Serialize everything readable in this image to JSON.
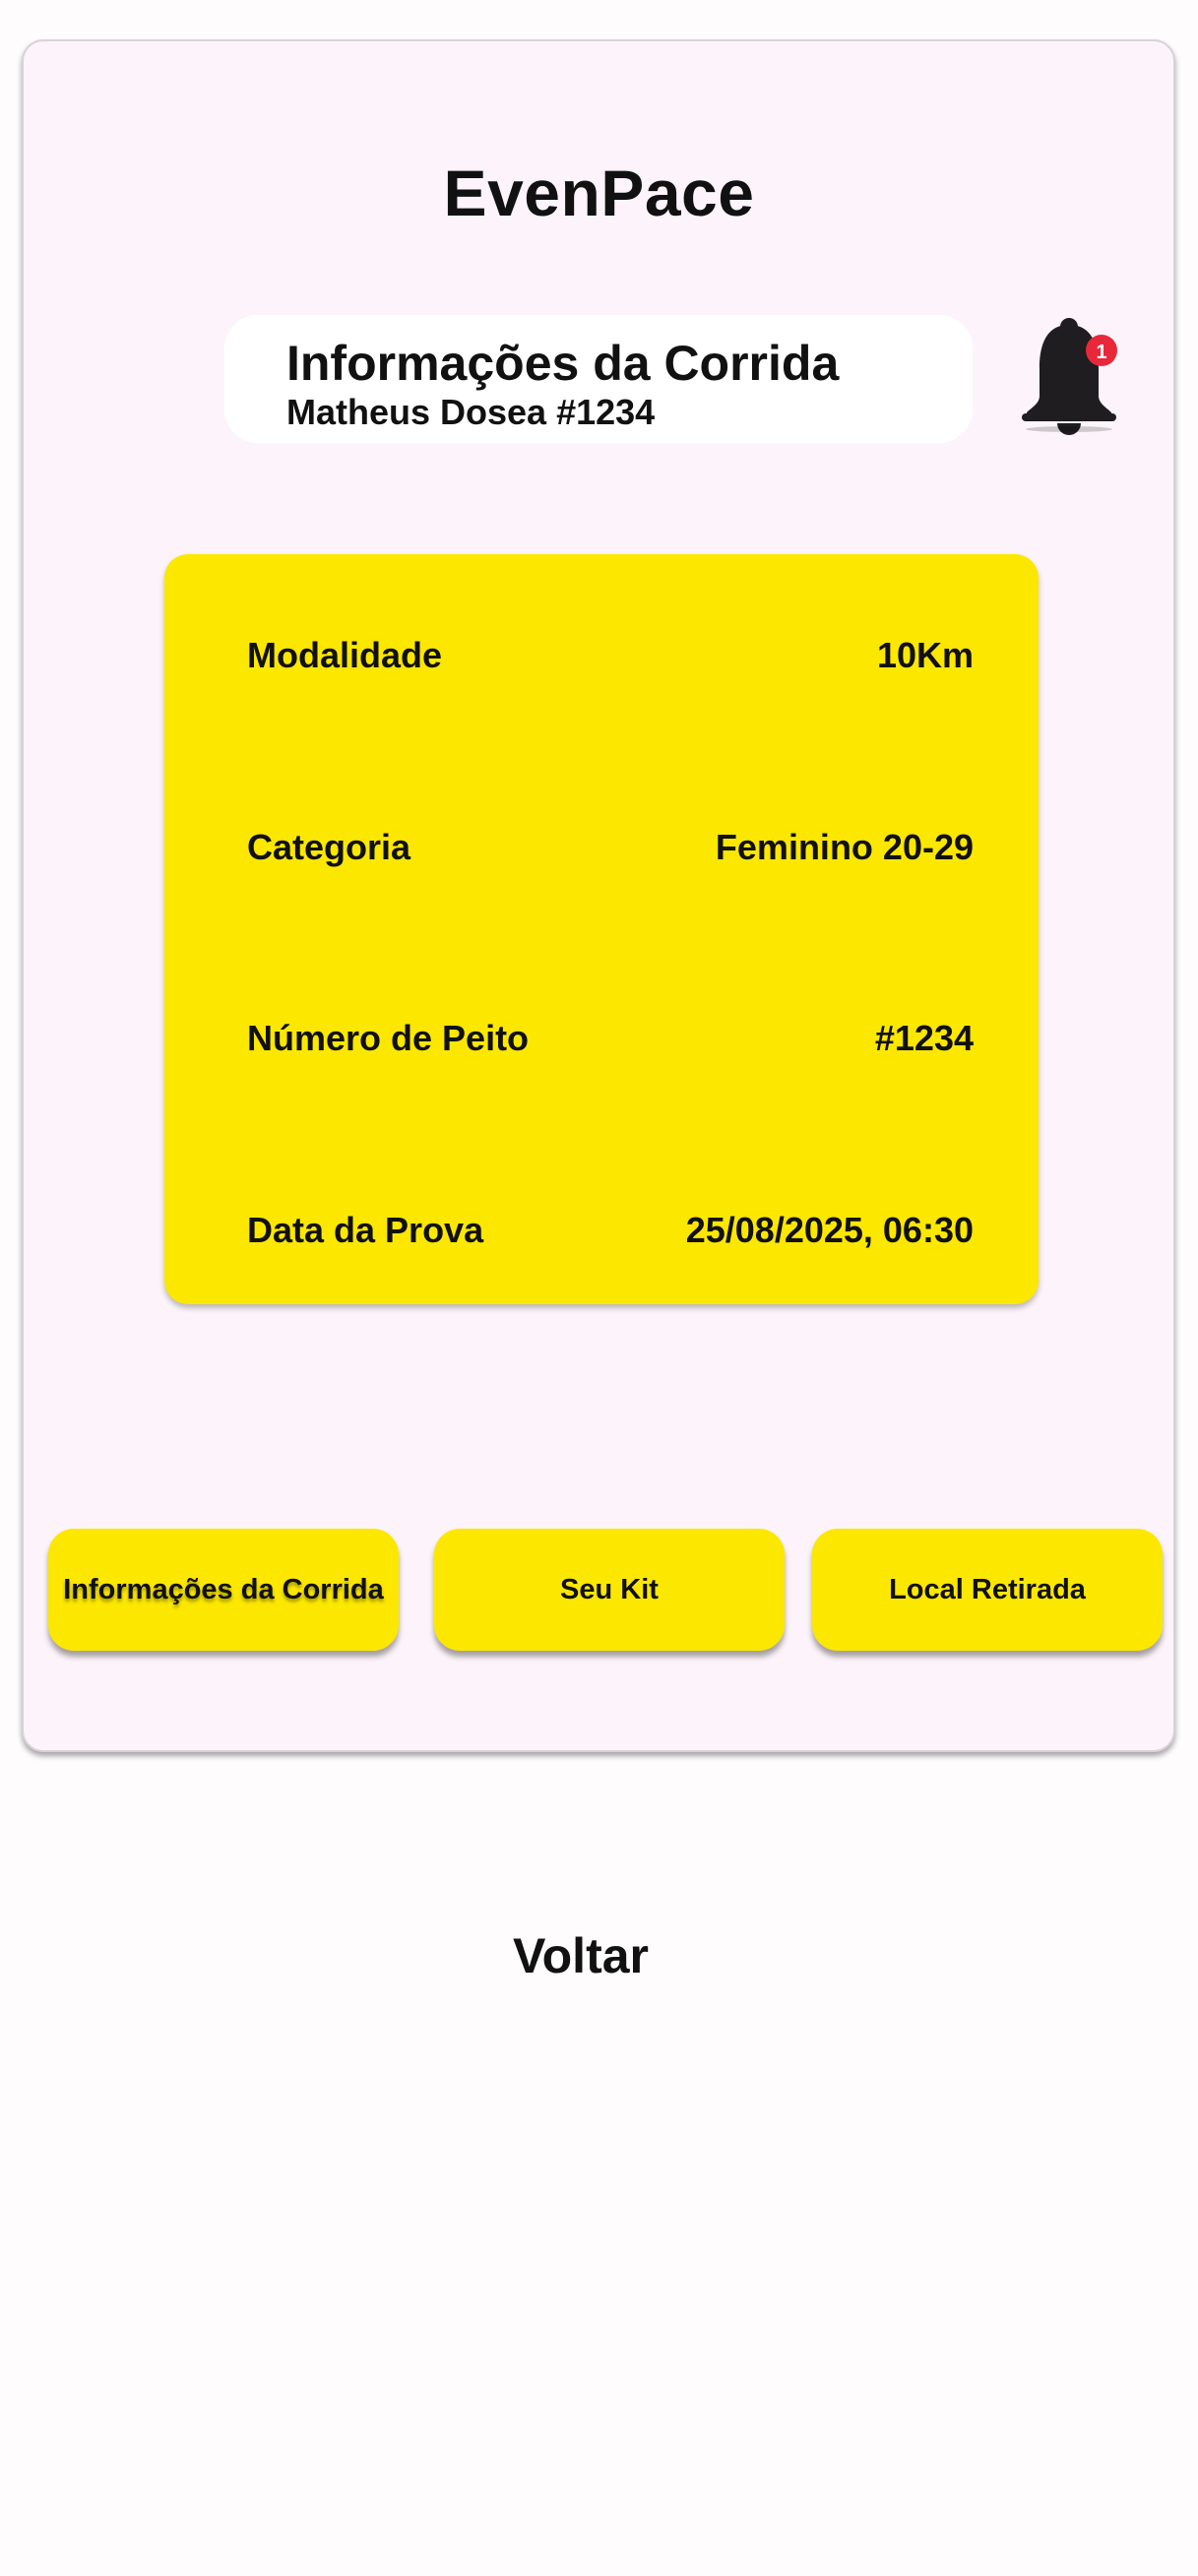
{
  "app": {
    "title": "EvenPace"
  },
  "header": {
    "title": "Informações da Corrida",
    "subtitle": "Matheus Dosea #1234"
  },
  "notifications": {
    "icon": "bell-icon",
    "count": "1",
    "badge_color": "#e8283a"
  },
  "info": {
    "rows": [
      {
        "label": "Modalidade",
        "value": "10Km"
      },
      {
        "label": "Categoria",
        "value": "Feminino 20-29"
      },
      {
        "label": "Número de Peito",
        "value": "#1234"
      },
      {
        "label": "Data da Prova",
        "value": "25/08/2025, 06:30"
      }
    ]
  },
  "tabs": [
    {
      "label": "Informações da Corrida",
      "active": true
    },
    {
      "label": "Seu Kit",
      "active": false
    },
    {
      "label": "Local Retirada",
      "active": false
    }
  ],
  "nav": {
    "back_label": "Voltar"
  },
  "colors": {
    "accent": "#fce700",
    "frame_background": "#fcf4fa",
    "page_background": "#fefcfc"
  }
}
